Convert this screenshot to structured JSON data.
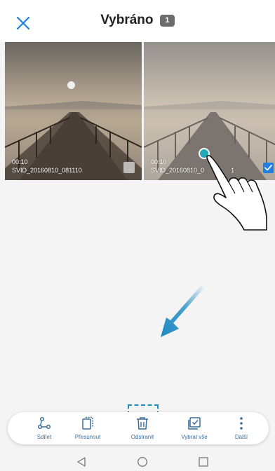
{
  "header": {
    "title": "Vybráno",
    "count": "1",
    "close_icon": "close-icon"
  },
  "thumbnails": [
    {
      "duration": "00:10",
      "filename": "SVID_20160810_081110",
      "selected": false
    },
    {
      "duration": "00:10",
      "filename": "SVID_20160810_0",
      "filename_end": "1",
      "selected": true
    }
  ],
  "toolbar": {
    "items": [
      {
        "label": "Sdílet",
        "icon": "share-icon"
      },
      {
        "label": "Přesunout",
        "icon": "move-icon"
      },
      {
        "label": "Odstranit",
        "icon": "trash-icon"
      },
      {
        "label": "Vybrat vše",
        "icon": "select-all-icon"
      },
      {
        "label": "Další",
        "icon": "more-icon"
      }
    ]
  },
  "colors": {
    "accent": "#1b7fe3",
    "tool_icon": "#3a6d9b",
    "highlight": "#1c8ac2",
    "tap_dot": "#22a8b8"
  }
}
